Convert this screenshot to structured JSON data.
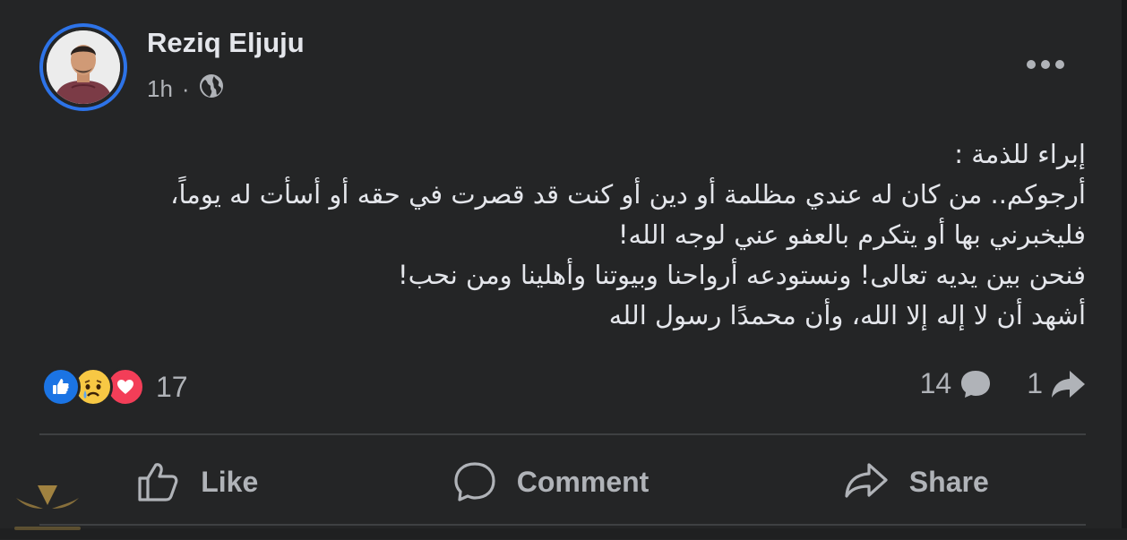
{
  "post": {
    "author": "Reziq Eljuju",
    "time": "1h",
    "separator": "·",
    "privacy_icon": "globe-icon",
    "more_icon": "more-options-icon",
    "text_lines": [
      "إبراء للذمة :",
      "أرجوكم.. من كان له عندي مظلمة أو دين أو كنت قد قصرت في حقه أو أسأت له يوماً،",
      "فليخبرني بها أو يتكرم بالعفو عني لوجه الله!",
      "فنحن بين يديه تعالى! ونستودعه أرواحنا وبيوتنا وأهلينا ومن نحب!",
      "أشهد أن لا إله إلا الله، وأن محمدًا رسول الله"
    ]
  },
  "reactions": {
    "icons": [
      "like-reaction-icon",
      "sad-reaction-icon",
      "love-reaction-icon"
    ],
    "count": "17"
  },
  "stats": {
    "comments": "14",
    "shares": "1"
  },
  "actions": {
    "like": "Like",
    "comment": "Comment",
    "share": "Share"
  },
  "colors": {
    "background": "#242526",
    "text": "#e4e6eb",
    "secondary_text": "#b0b3b8",
    "avatar_ring": "#2d73e8",
    "like_blue": "#1b74e4",
    "love_red": "#f33e58",
    "sad_yellow": "#f7c844"
  }
}
